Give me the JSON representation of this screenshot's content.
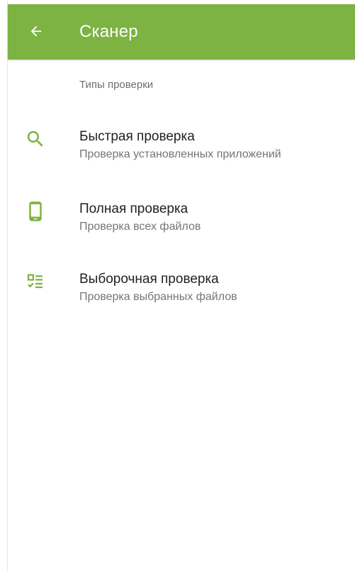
{
  "app_bar": {
    "title": "Сканер",
    "back_icon": "arrow-back-icon",
    "color": "#7cb342"
  },
  "section": {
    "header": "Типы проверки"
  },
  "items": [
    {
      "title": "Быстрая проверка",
      "subtitle": "Проверка установленных приложений",
      "icon": "search-icon"
    },
    {
      "title": "Полная проверка",
      "subtitle": "Проверка всех файлов",
      "icon": "smartphone-icon"
    },
    {
      "title": "Выборочная проверка",
      "subtitle": "Проверка выбранных файлов",
      "icon": "checklist-icon"
    }
  ],
  "colors": {
    "accent": "#7cb342",
    "primary_text": "#212121",
    "secondary_text": "#757575"
  }
}
